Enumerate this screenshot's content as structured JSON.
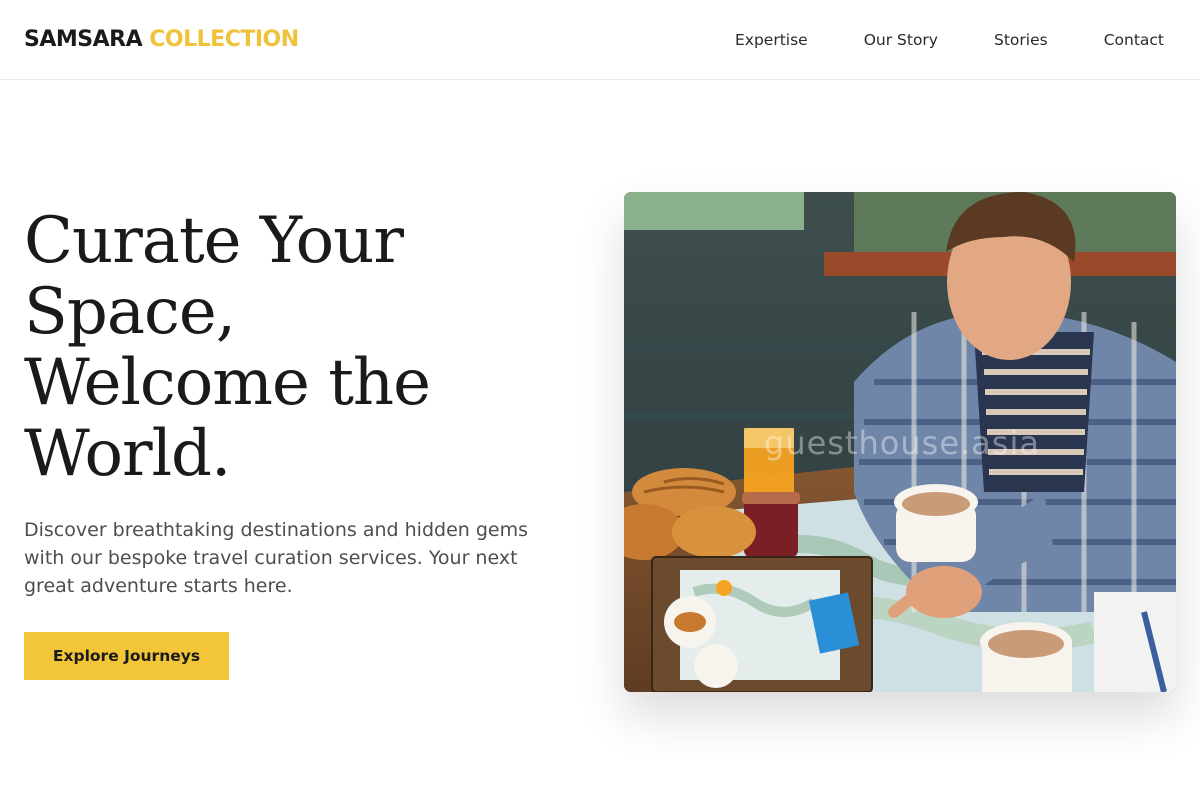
{
  "brand": {
    "name_part1": "SAMSARA",
    "name_part2": "COLLECTION",
    "accent_color": "#f0c23a"
  },
  "nav": {
    "items": [
      {
        "label": "Expertise"
      },
      {
        "label": "Our Story"
      },
      {
        "label": "Stories"
      },
      {
        "label": "Contact"
      }
    ]
  },
  "hero": {
    "title_lines": [
      "Curate Your",
      "Space,",
      "Welcome the",
      "World."
    ],
    "subtitle": "Discover breathtaking destinations and hidden gems with our bespoke travel curation services. Your next great adventure starts here.",
    "cta_label": "Explore Journeys",
    "cta_color": "#f3c538",
    "image_watermark": "guesthouse.asia"
  }
}
